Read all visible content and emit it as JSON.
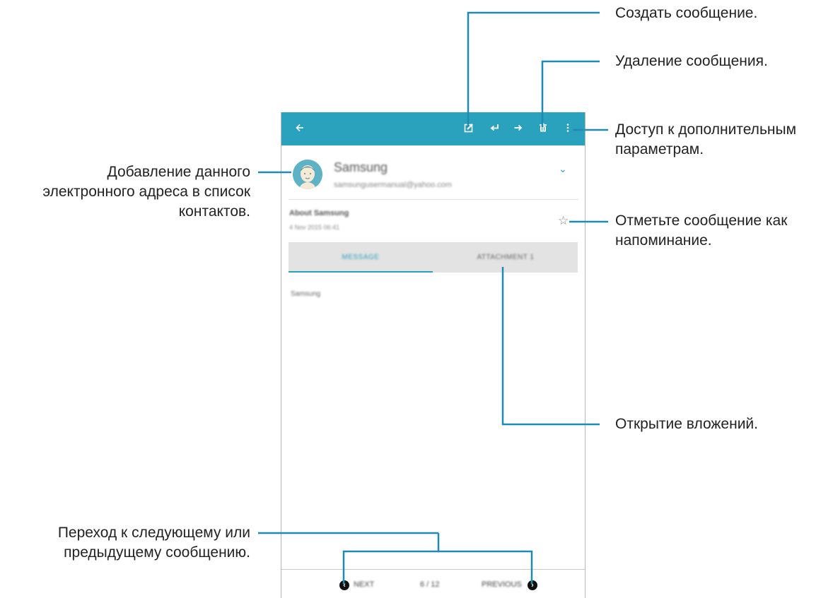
{
  "callouts": {
    "compose": "Создать сообщение.",
    "delete": "Удаление сообщения.",
    "more_line1": "Доступ к дополнительным",
    "more_line2": "параметрам.",
    "add_contact_line1": "Добавление данного",
    "add_contact_line2": "электронного адреса в список",
    "add_contact_line3": "контактов.",
    "star_line1": "Отметьте сообщение как",
    "star_line2": "напоминание.",
    "attachments": "Открытие вложений.",
    "navigate_line1": "Переход к следующему или",
    "navigate_line2": "предыдущему сообщению."
  },
  "phone": {
    "toolbar": {
      "icons": [
        "back-arrow-icon",
        "compose-icon",
        "reply-icon",
        "forward-icon",
        "delete-icon",
        "more-options-icon"
      ],
      "color": "#2aa1bd"
    },
    "sender": {
      "name": "Samsung",
      "email": "samsungusermanual@yahoo.com"
    },
    "subject": "About Samsung",
    "date": "4 Nov 2015 06:41",
    "tabs": [
      "MESSAGE",
      "ATTACHMENT 1"
    ],
    "body": "Samsung",
    "bottom": {
      "next": "NEXT",
      "counter": "6 / 12",
      "previous": "PREVIOUS"
    }
  },
  "colors": {
    "accent": "#2aa1bd",
    "callout_line": "#1f8ab3"
  }
}
